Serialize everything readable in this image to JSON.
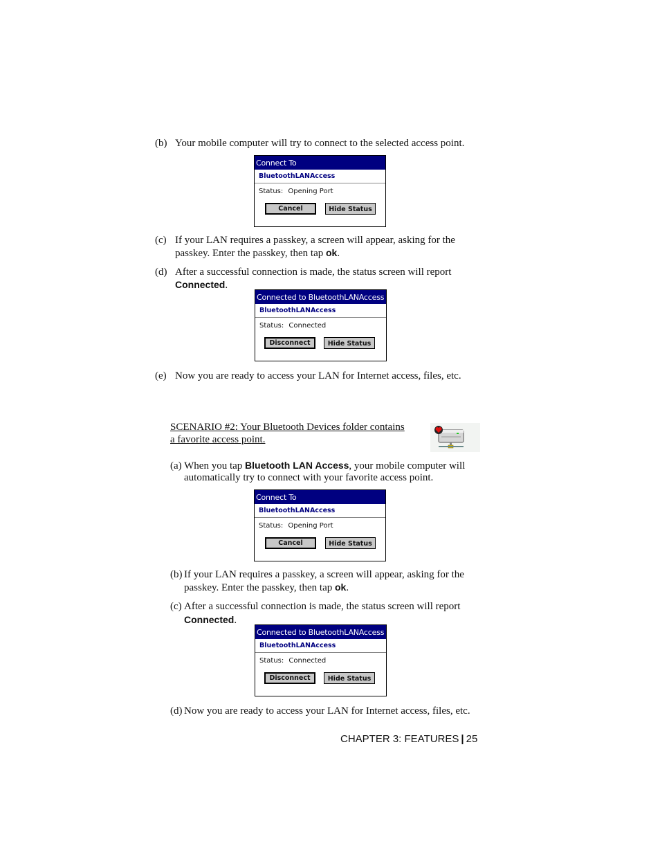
{
  "scenario1": {
    "step_b": {
      "label": "(b)",
      "text": "Your mobile computer will try to connect to the selected access point."
    },
    "dialog_connect": {
      "title": "Connect To",
      "device": "BluetoothLANAccess",
      "status_label": "Status:",
      "status_value": "Opening Port",
      "buttons": [
        "Cancel",
        "Hide Status"
      ]
    },
    "step_c": {
      "label": "(c)",
      "line1": "If your LAN requires a passkey, a screen will appear, asking for the",
      "line2_pre": "passkey.  Enter the passkey, then tap ",
      "line2_bold": "ok",
      "line2_post": "."
    },
    "step_d": {
      "label": "(d)",
      "line1": "After a successful connection is made, the status screen will report",
      "line2_bold": "Connected",
      "line2_post": "."
    },
    "dialog_connected": {
      "title": "Connected to BluetoothLANAccess",
      "device": "BluetoothLANAccess",
      "status_label": "Status:",
      "status_value": "Connected",
      "buttons": [
        "Disconnect",
        "Hide Status"
      ]
    },
    "step_e": {
      "label": "(e)",
      "text": "Now you are ready to access your LAN for Internet access, files, etc."
    }
  },
  "scenario2": {
    "heading_line1": "SCENARIO #2: Your Bluetooth Devices folder contains",
    "heading_line2": "a favorite access point.",
    "icon": "favorite-access-point-icon",
    "step_a": {
      "label": "(a)",
      "line1_pre": "When you tap ",
      "line1_bold": "Bluetooth LAN Access",
      "line1_post": ", your mobile computer will",
      "line2": "automatically try to connect with your favorite access point."
    },
    "dialog_connect": {
      "title": "Connect To",
      "device": "BluetoothLANAccess",
      "status_label": "Status:",
      "status_value": "Opening Port",
      "buttons": [
        "Cancel",
        "Hide Status"
      ]
    },
    "step_b": {
      "label": "(b)",
      "line1": "If your LAN requires a passkey, a screen will appear, asking for the",
      "line2_pre": "passkey.  Enter the passkey, then tap ",
      "line2_bold": "ok",
      "line2_post": "."
    },
    "step_c": {
      "label": "(c)",
      "line1": "After a successful connection is made, the status screen will report",
      "line2_bold": "Connected",
      "line2_post": "."
    },
    "dialog_connected": {
      "title": "Connected to BluetoothLANAccess",
      "device": "BluetoothLANAccess",
      "status_label": "Status:",
      "status_value": "Connected",
      "buttons": [
        "Disconnect",
        "Hide Status"
      ]
    },
    "step_d": {
      "label": "(d)",
      "text": "Now you are ready to access your LAN for Internet access, files, etc."
    }
  },
  "footer": {
    "chapter": "CHAPTER 3: FEATURES",
    "separator": "|",
    "page": "25"
  }
}
